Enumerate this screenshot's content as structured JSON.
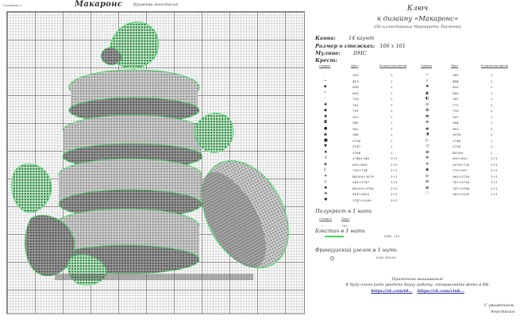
{
  "sheet": {
    "page_label": "Страница 1",
    "title": "Макаронс",
    "author": "Кружева Анастасия"
  },
  "key": {
    "title": "Ключ",
    "subtitle": "к дизайну «Макаронс»",
    "credit": "(По иллюстрации Маргариты Ткаченко)",
    "canvas_label": "Канва:",
    "canvas_value": "14 каунт",
    "size_label": "Размер в стежках:",
    "size_value": "106 x 101",
    "floss_label": "Мулине:",
    "floss_value": "DMC",
    "cross_label": "Крест:",
    "col_headers": [
      "Символ",
      "Цвет",
      "Количество нитей",
      "Символ",
      "Цвет",
      "Количество нитей"
    ],
    "rows_left": [
      {
        "sym": "·",
        "color": "318",
        "count": "2"
      },
      {
        "sym": "−",
        "color": "415",
        "count": "2"
      },
      {
        "sym": "▪",
        "color": "608",
        "count": "2"
      },
      {
        "sym": "•",
        "color": "605",
        "count": "2"
      },
      {
        "sym": "◦",
        "color": "726",
        "count": "2"
      },
      {
        "sym": "✚",
        "color": "762",
        "count": "1"
      },
      {
        "sym": "◆",
        "color": "791",
        "count": "2"
      },
      {
        "sym": "✖",
        "color": "907",
        "count": "2"
      },
      {
        "sym": "◘",
        "color": "945",
        "count": "2"
      },
      {
        "sym": "●",
        "color": "962",
        "count": "2"
      },
      {
        "sym": "▲",
        "color": "988",
        "count": "2"
      },
      {
        "sym": "■",
        "color": "3716",
        "count": "2"
      },
      {
        "sym": "▼",
        "color": "3747",
        "count": "2"
      },
      {
        "sym": "♦",
        "color": "3766",
        "count": "2"
      },
      {
        "sym": "↕",
        "color": "3746+340",
        "count": "1+1"
      },
      {
        "sym": "◈",
        "color": "603+605",
        "count": "1+1"
      },
      {
        "sym": "◊",
        "color": "793+794",
        "count": "1+1"
      },
      {
        "sym": "✦",
        "color": "B5200+3078",
        "count": "1+1"
      },
      {
        "sym": "◇",
        "color": "341+3747",
        "count": "1+1"
      },
      {
        "sym": "♣",
        "color": "B5200+3756",
        "count": "1+1"
      },
      {
        "sym": "⊕",
        "color": "414+3820",
        "count": "1+1"
      },
      {
        "sym": "♥",
        "color": "3747+5200",
        "count": "1+1"
      }
    ],
    "rows_right": [
      {
        "sym": "∼",
        "color": "341",
        "count": "2"
      },
      {
        "sym": "✓",
        "color": "444",
        "count": "2"
      },
      {
        "sym": "♠",
        "color": "602",
        "count": "2"
      },
      {
        "sym": "▲",
        "color": "645",
        "count": "2"
      },
      {
        "sym": "◐",
        "color": "747",
        "count": "2"
      },
      {
        "sym": "⊙",
        "color": "772",
        "count": "2"
      },
      {
        "sym": "✿",
        "color": "793",
        "count": "2"
      },
      {
        "sym": "◓",
        "color": "907",
        "count": "2"
      },
      {
        "sym": "⊗",
        "color": "964",
        "count": "2"
      },
      {
        "sym": "◒",
        "color": "963",
        "count": "2"
      },
      {
        "sym": "◑",
        "color": "3078",
        "count": "2"
      },
      {
        "sym": "▷",
        "color": "3746",
        "count": "2"
      },
      {
        "sym": "◁",
        "color": "3756",
        "count": "2"
      },
      {
        "sym": "⊞",
        "color": "B5200",
        "count": "2"
      },
      {
        "sym": "✜",
        "color": "605+603",
        "count": "1+1"
      },
      {
        "sym": "✛",
        "color": "3078+726",
        "count": "1+1"
      },
      {
        "sym": "◉",
        "color": "775+907",
        "count": "1+1"
      },
      {
        "sym": "⊘",
        "color": "963+3716",
        "count": "1+1"
      },
      {
        "sym": "⊟",
        "color": "747+3756",
        "count": "1+1"
      },
      {
        "sym": "⊠",
        "color": "747+3766",
        "count": "1+1"
      },
      {
        "sym": "♡",
        "color": "963+5200",
        "count": "1+1"
      }
    ],
    "half_title": "Полукрест в 1 нить",
    "half_col_sym": "Символ",
    "half_col_color": "Цвет",
    "half_sym": "⁄",
    "half_color": "762",
    "backstitch_title": "Бэкстич в 1 нить",
    "backstitch_value": "DMC 310",
    "knot_title": "Французский узелок в 1 нить",
    "knot_value": "DMC B5200",
    "footer_line1": "Приятного вышивания!",
    "footer_line2": "Я буду очень рада увидеть Вашу работу, отправляйте фото в ВК:",
    "link1": "https://vk.com/id...",
    "link2": "https://vk.com/club...",
    "sign1": "С уважением,",
    "sign2": "Анастасия."
  },
  "colors": {
    "accent_green": "#3bd65c",
    "dark_green": "#1f7a34",
    "grey_fill": "#bdbdbd"
  }
}
